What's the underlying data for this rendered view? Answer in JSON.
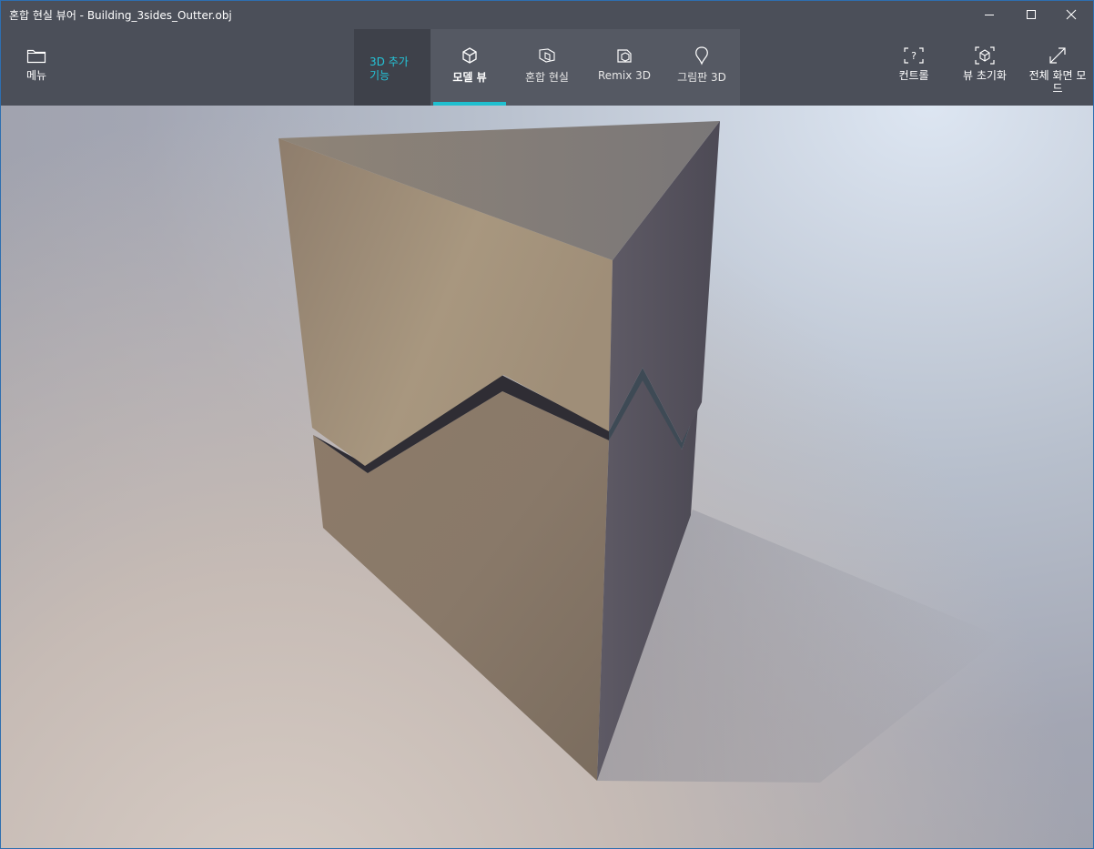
{
  "window": {
    "title": "혼합 현실 뷰어 - Building_3sides_Outter.obj",
    "controls": [
      "minimize-icon",
      "maximize-icon",
      "close-icon"
    ]
  },
  "toolbar": {
    "menu": {
      "label": "메뉴",
      "icon": "folder-icon"
    },
    "addon_tab": {
      "line1": "3D 추가",
      "line2": "기능"
    },
    "tabs": [
      {
        "label": "모델 뷰",
        "icon": "cube-icon",
        "active": true
      },
      {
        "label": "혼합 현실",
        "icon": "mixed-reality-icon",
        "active": false
      },
      {
        "label": "Remix 3D",
        "icon": "remix-icon",
        "active": false
      },
      {
        "label": "그림판 3D",
        "icon": "paint3d-icon",
        "active": false
      }
    ],
    "right": [
      {
        "label": "컨트롤",
        "icon": "help-frame-icon"
      },
      {
        "label": "뷰 초기화",
        "icon": "reset-view-icon"
      },
      {
        "label": "전체 화면 모드",
        "label_line1": "전체 화면 모",
        "label_line2": "드",
        "icon": "fullscreen-icon"
      }
    ]
  },
  "colors": {
    "titlebar": "#4b4f59",
    "accent": "#1fbfcf",
    "model_front": "#a08e78",
    "model_side": "#5e5a64",
    "model_top": "#8d8279"
  }
}
